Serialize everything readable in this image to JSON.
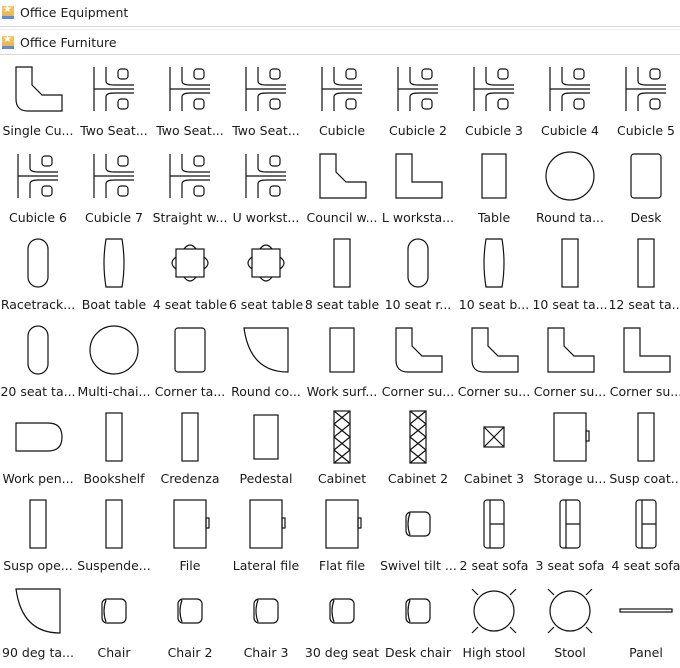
{
  "libraries": [
    {
      "title": "Office Equipment",
      "icon": "library-star-icon"
    },
    {
      "title": "Office Furniture",
      "icon": "library-star-icon"
    }
  ],
  "shapes": [
    {
      "label": "Single Cu...",
      "icon": "single-cubicle-icon"
    },
    {
      "label": "Two Seat...",
      "icon": "two-seat-cubicle-icon"
    },
    {
      "label": "Two Seat...",
      "icon": "two-seat-cubicle-2-icon"
    },
    {
      "label": "Two Seat...",
      "icon": "two-seat-cubicle-3-icon"
    },
    {
      "label": "Cubicle",
      "icon": "cubicle-icon"
    },
    {
      "label": "Cubicle 2",
      "icon": "cubicle-2-icon"
    },
    {
      "label": "Cubicle 3",
      "icon": "cubicle-3-icon"
    },
    {
      "label": "Cubicle 4",
      "icon": "cubicle-4-icon"
    },
    {
      "label": "Cubicle 5",
      "icon": "cubicle-5-icon"
    },
    {
      "label": "Cubicle 6",
      "icon": "cubicle-6-icon"
    },
    {
      "label": "Cubicle 7",
      "icon": "cubicle-7-icon"
    },
    {
      "label": "Straight w...",
      "icon": "straight-workstation-icon"
    },
    {
      "label": "U workst...",
      "icon": "u-workstation-icon"
    },
    {
      "label": "Council w...",
      "icon": "council-workstation-icon"
    },
    {
      "label": "L worksta...",
      "icon": "l-workstation-icon"
    },
    {
      "label": "Table",
      "icon": "table-icon"
    },
    {
      "label": "Round ta...",
      "icon": "round-table-icon"
    },
    {
      "label": "Desk",
      "icon": "desk-icon"
    },
    {
      "label": "Racetrack...",
      "icon": "racetrack-table-icon"
    },
    {
      "label": "Boat table",
      "icon": "boat-table-icon"
    },
    {
      "label": "4 seat table",
      "icon": "four-seat-table-icon"
    },
    {
      "label": "6 seat table",
      "icon": "six-seat-table-icon"
    },
    {
      "label": "8 seat table",
      "icon": "eight-seat-table-icon"
    },
    {
      "label": "10 seat r...",
      "icon": "ten-seat-racetrack-icon"
    },
    {
      "label": "10 seat b...",
      "icon": "ten-seat-boat-icon"
    },
    {
      "label": "10 seat ta...",
      "icon": "ten-seat-table-icon"
    },
    {
      "label": "12 seat ta...",
      "icon": "twelve-seat-table-icon"
    },
    {
      "label": "20 seat ta...",
      "icon": "twenty-seat-table-icon"
    },
    {
      "label": "Multi-chai...",
      "icon": "multi-chair-table-icon"
    },
    {
      "label": "Corner ta...",
      "icon": "corner-table-icon"
    },
    {
      "label": "Round co...",
      "icon": "round-corner-icon"
    },
    {
      "label": "Work surf...",
      "icon": "work-surface-icon"
    },
    {
      "label": "Corner su...",
      "icon": "corner-surface-icon"
    },
    {
      "label": "Corner su...",
      "icon": "corner-surface-2-icon"
    },
    {
      "label": "Corner su...",
      "icon": "corner-surface-3-icon"
    },
    {
      "label": "Corner su...",
      "icon": "corner-surface-4-icon"
    },
    {
      "label": "Work pen...",
      "icon": "work-peninsula-icon"
    },
    {
      "label": "Bookshelf",
      "icon": "bookshelf-icon"
    },
    {
      "label": "Credenza",
      "icon": "credenza-icon"
    },
    {
      "label": "Pedestal",
      "icon": "pedestal-icon"
    },
    {
      "label": "Cabinet",
      "icon": "cabinet-icon"
    },
    {
      "label": "Cabinet 2",
      "icon": "cabinet-2-icon"
    },
    {
      "label": "Cabinet 3",
      "icon": "cabinet-3-icon"
    },
    {
      "label": "Storage u...",
      "icon": "storage-unit-icon"
    },
    {
      "label": "Susp coat...",
      "icon": "suspended-coat-icon"
    },
    {
      "label": "Susp ope...",
      "icon": "suspended-open-icon"
    },
    {
      "label": "Suspende...",
      "icon": "suspended-icon"
    },
    {
      "label": "File",
      "icon": "file-icon"
    },
    {
      "label": "Lateral file",
      "icon": "lateral-file-icon"
    },
    {
      "label": "Flat file",
      "icon": "flat-file-icon"
    },
    {
      "label": "Swivel tilt ...",
      "icon": "swivel-tilt-chair-icon"
    },
    {
      "label": "2 seat sofa",
      "icon": "two-seat-sofa-icon"
    },
    {
      "label": "3 seat sofa",
      "icon": "three-seat-sofa-icon"
    },
    {
      "label": "4 seat sofa",
      "icon": "four-seat-sofa-icon"
    },
    {
      "label": "90 deg ta...",
      "icon": "ninety-deg-table-icon"
    },
    {
      "label": "Chair",
      "icon": "chair-icon"
    },
    {
      "label": "Chair 2",
      "icon": "chair-2-icon"
    },
    {
      "label": "Chair 3",
      "icon": "chair-3-icon"
    },
    {
      "label": "30 deg seat",
      "icon": "thirty-deg-seat-icon"
    },
    {
      "label": "Desk chair",
      "icon": "desk-chair-icon"
    },
    {
      "label": "High stool",
      "icon": "high-stool-icon"
    },
    {
      "label": "Stool",
      "icon": "stool-icon"
    },
    {
      "label": "Panel",
      "icon": "panel-icon"
    }
  ]
}
